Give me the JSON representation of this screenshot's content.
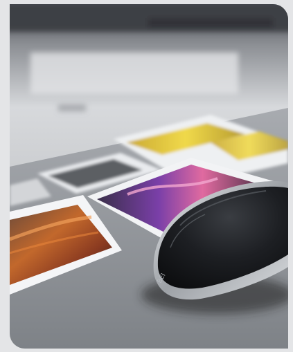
{
  "photo": {
    "subject": "computer-mouse-on-printed-photos",
    "mouse_marking": "BEI",
    "colors": {
      "background": "#e4e5e7",
      "desk": "#8f9398",
      "wall": "#d9dadd",
      "mouse_body": "#1a1c1f",
      "mouse_trim": "#c9ccd0",
      "print_yellow": "#e3c93a",
      "print_purple": "#7a3fa8",
      "print_orange": "#c86a2a"
    }
  }
}
